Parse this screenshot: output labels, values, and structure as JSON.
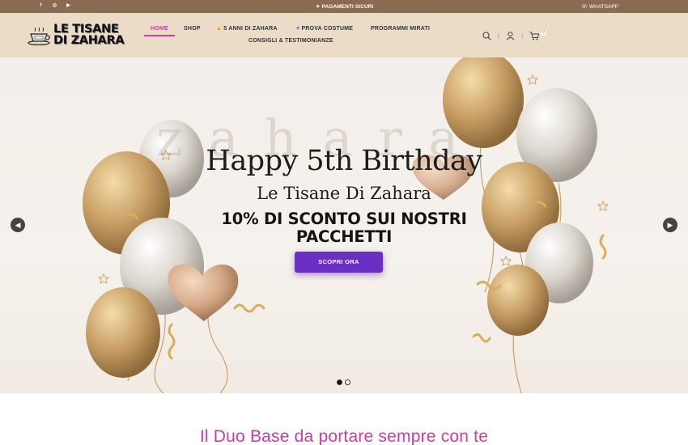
{
  "topbar": {
    "social_icons": [
      "facebook-icon",
      "instagram-icon",
      "youtube-icon"
    ],
    "secure_payments": "PAGAMENTI SICURI",
    "whatsapp": "WHATSAPP"
  },
  "header": {
    "logo_line1": "LE TISANE",
    "logo_line2": "DI ZAHARA",
    "nav": {
      "home": "HOME",
      "shop": "SHOP",
      "anni": "5 ANNI DI ZAHARA",
      "prova": "PROVA COSTUME",
      "programmi": "PROGRAMMI MIRATI",
      "consigli": "CONSIGLI & TESTIMONIANZE"
    },
    "cart_count": "0"
  },
  "hero": {
    "watermark": "zahara",
    "title": "Happy 5th Birthday",
    "subtitle": "Le Tisane Di Zahara",
    "promo_line1": "10% DI SCONTO SUI NOSTRI",
    "promo_line2": "PACCHETTI",
    "button": "SCOPRI ORA",
    "slides": 2,
    "active_slide": 1
  },
  "section": {
    "title": "Il Duo Base da portare sempre con te"
  },
  "colors": {
    "topbar": "#8a6a50",
    "header": "#ebdcc7",
    "accent": "#d63fa0",
    "button": "#6a2fc5"
  }
}
